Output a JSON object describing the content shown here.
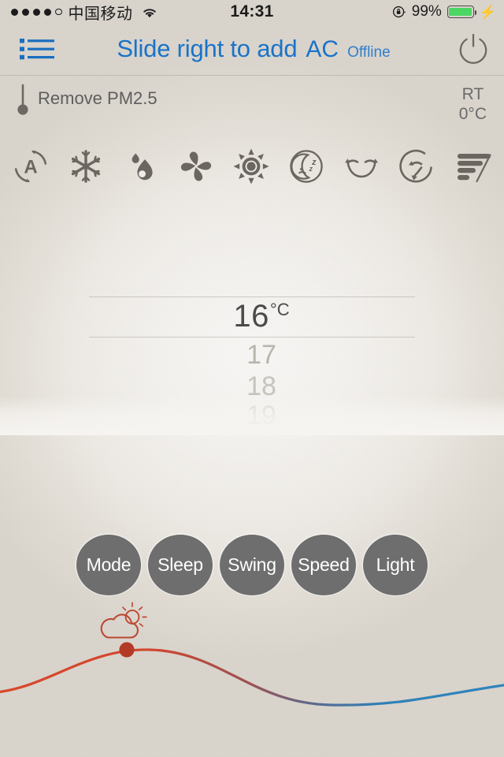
{
  "status_bar": {
    "signal_dots_total": 5,
    "signal_dots_filled": 4,
    "carrier": "中国移动",
    "wifi_icon": "wifi-icon",
    "time": "14:31",
    "rotation_lock_icon": "rotation-lock-icon",
    "battery_percent": "99%",
    "battery_level": 99,
    "battery_color": "#4cd764",
    "charging_icon": "⚡"
  },
  "title_bar": {
    "menu_icon": "list-menu-icon",
    "title": "Slide right to add",
    "device_name": "AC",
    "connection_state": "Offline",
    "power_icon": "power-icon",
    "accent_color": "#1a73c8"
  },
  "info_row": {
    "pm_icon": "thermometer-icon",
    "pm_label": "Remove PM2.5",
    "room_temp_label": "RT",
    "room_temp_value": "0°C"
  },
  "mode_icons": [
    {
      "name": "auto-mode-icon",
      "label": "Auto"
    },
    {
      "name": "cool-mode-icon",
      "label": "Cool"
    },
    {
      "name": "dry-mode-icon",
      "label": "Dry"
    },
    {
      "name": "fan-mode-icon",
      "label": "Fan"
    },
    {
      "name": "heat-mode-icon",
      "label": "Heat"
    },
    {
      "name": "sleep-mode-icon",
      "label": "Sleep"
    },
    {
      "name": "swing-mode-icon",
      "label": "Swing"
    },
    {
      "name": "circulate-mode-icon",
      "label": "Circulate"
    },
    {
      "name": "fan-speed-icon",
      "label": "Fan speed"
    }
  ],
  "temperature_picker": {
    "selected_value": "16",
    "unit": "°C",
    "next_values": [
      "17",
      "18",
      "19"
    ],
    "selected_color": "#4a4a4a"
  },
  "control_buttons": [
    {
      "name": "mode-button",
      "label": "Mode"
    },
    {
      "name": "sleep-button",
      "label": "Sleep"
    },
    {
      "name": "swing-button",
      "label": "Swing"
    },
    {
      "name": "speed-button",
      "label": "Speed"
    },
    {
      "name": "light-button",
      "label": "Light"
    }
  ],
  "weather_curve": {
    "weather_icon": "partly-cloudy-icon",
    "marker_color": "#b23a26",
    "warm_color": "#d84a2e",
    "cool_color": "#2b82b8"
  }
}
